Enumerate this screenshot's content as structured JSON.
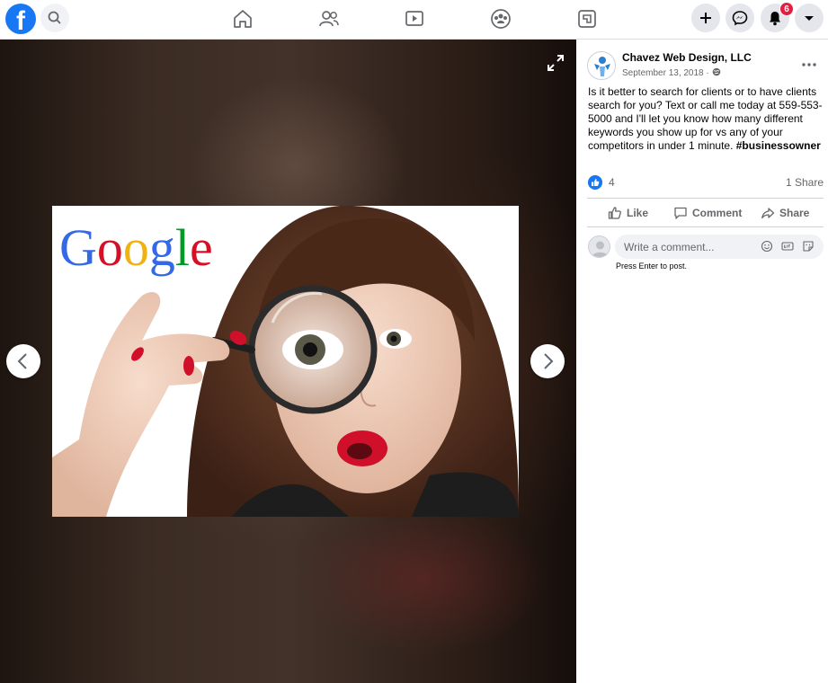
{
  "topbar": {
    "logo": "f",
    "notifications_count": "6",
    "icons": [
      "facebook-logo",
      "search-icon",
      "home-icon",
      "friends-icon",
      "watch-icon",
      "groups-icon",
      "gaming-icon",
      "plus-icon",
      "messenger-icon",
      "bell-icon",
      "caret-down-icon"
    ]
  },
  "viewer": {
    "photo_logo_text": "Google"
  },
  "post": {
    "page_name": "Chavez Web Design, LLC",
    "date": "September 13, 2018 · ",
    "text": "Is it better to search for clients or to have clients search for you? Text or call me today at 559-553-5000 and I'll let you know how many different keywords you show up for vs any of your competitors in under 1 minute. ",
    "hashtag": "#businessowner",
    "like_count": "4",
    "share_count": "1 Share"
  },
  "actions": {
    "like": "Like",
    "comment": "Comment",
    "share": "Share"
  },
  "comment": {
    "placeholder": "Write a comment...",
    "hint": "Press Enter to post."
  },
  "colors": {
    "brand": "#1877f2",
    "badge": "#e41e3f",
    "secondary_text": "#65676b"
  }
}
